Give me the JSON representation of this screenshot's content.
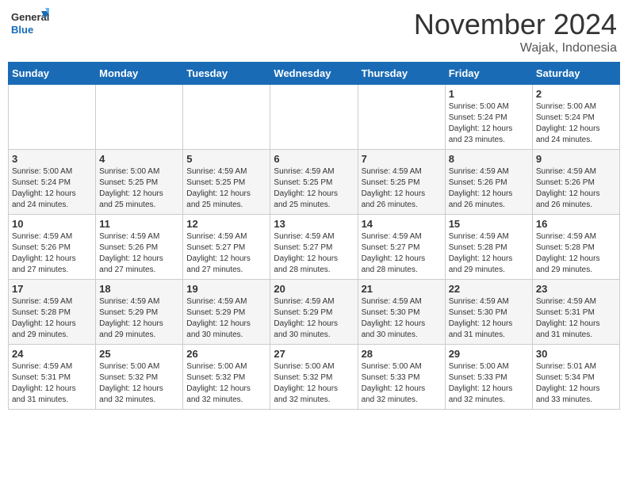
{
  "header": {
    "logo_general": "General",
    "logo_blue": "Blue",
    "month_title": "November 2024",
    "location": "Wajak, Indonesia"
  },
  "weekdays": [
    "Sunday",
    "Monday",
    "Tuesday",
    "Wednesday",
    "Thursday",
    "Friday",
    "Saturday"
  ],
  "weeks": [
    [
      {
        "day": "",
        "info": ""
      },
      {
        "day": "",
        "info": ""
      },
      {
        "day": "",
        "info": ""
      },
      {
        "day": "",
        "info": ""
      },
      {
        "day": "",
        "info": ""
      },
      {
        "day": "1",
        "info": "Sunrise: 5:00 AM\nSunset: 5:24 PM\nDaylight: 12 hours\nand 23 minutes."
      },
      {
        "day": "2",
        "info": "Sunrise: 5:00 AM\nSunset: 5:24 PM\nDaylight: 12 hours\nand 24 minutes."
      }
    ],
    [
      {
        "day": "3",
        "info": "Sunrise: 5:00 AM\nSunset: 5:24 PM\nDaylight: 12 hours\nand 24 minutes."
      },
      {
        "day": "4",
        "info": "Sunrise: 5:00 AM\nSunset: 5:25 PM\nDaylight: 12 hours\nand 25 minutes."
      },
      {
        "day": "5",
        "info": "Sunrise: 4:59 AM\nSunset: 5:25 PM\nDaylight: 12 hours\nand 25 minutes."
      },
      {
        "day": "6",
        "info": "Sunrise: 4:59 AM\nSunset: 5:25 PM\nDaylight: 12 hours\nand 25 minutes."
      },
      {
        "day": "7",
        "info": "Sunrise: 4:59 AM\nSunset: 5:25 PM\nDaylight: 12 hours\nand 26 minutes."
      },
      {
        "day": "8",
        "info": "Sunrise: 4:59 AM\nSunset: 5:26 PM\nDaylight: 12 hours\nand 26 minutes."
      },
      {
        "day": "9",
        "info": "Sunrise: 4:59 AM\nSunset: 5:26 PM\nDaylight: 12 hours\nand 26 minutes."
      }
    ],
    [
      {
        "day": "10",
        "info": "Sunrise: 4:59 AM\nSunset: 5:26 PM\nDaylight: 12 hours\nand 27 minutes."
      },
      {
        "day": "11",
        "info": "Sunrise: 4:59 AM\nSunset: 5:26 PM\nDaylight: 12 hours\nand 27 minutes."
      },
      {
        "day": "12",
        "info": "Sunrise: 4:59 AM\nSunset: 5:27 PM\nDaylight: 12 hours\nand 27 minutes."
      },
      {
        "day": "13",
        "info": "Sunrise: 4:59 AM\nSunset: 5:27 PM\nDaylight: 12 hours\nand 28 minutes."
      },
      {
        "day": "14",
        "info": "Sunrise: 4:59 AM\nSunset: 5:27 PM\nDaylight: 12 hours\nand 28 minutes."
      },
      {
        "day": "15",
        "info": "Sunrise: 4:59 AM\nSunset: 5:28 PM\nDaylight: 12 hours\nand 29 minutes."
      },
      {
        "day": "16",
        "info": "Sunrise: 4:59 AM\nSunset: 5:28 PM\nDaylight: 12 hours\nand 29 minutes."
      }
    ],
    [
      {
        "day": "17",
        "info": "Sunrise: 4:59 AM\nSunset: 5:28 PM\nDaylight: 12 hours\nand 29 minutes."
      },
      {
        "day": "18",
        "info": "Sunrise: 4:59 AM\nSunset: 5:29 PM\nDaylight: 12 hours\nand 29 minutes."
      },
      {
        "day": "19",
        "info": "Sunrise: 4:59 AM\nSunset: 5:29 PM\nDaylight: 12 hours\nand 30 minutes."
      },
      {
        "day": "20",
        "info": "Sunrise: 4:59 AM\nSunset: 5:29 PM\nDaylight: 12 hours\nand 30 minutes."
      },
      {
        "day": "21",
        "info": "Sunrise: 4:59 AM\nSunset: 5:30 PM\nDaylight: 12 hours\nand 30 minutes."
      },
      {
        "day": "22",
        "info": "Sunrise: 4:59 AM\nSunset: 5:30 PM\nDaylight: 12 hours\nand 31 minutes."
      },
      {
        "day": "23",
        "info": "Sunrise: 4:59 AM\nSunset: 5:31 PM\nDaylight: 12 hours\nand 31 minutes."
      }
    ],
    [
      {
        "day": "24",
        "info": "Sunrise: 4:59 AM\nSunset: 5:31 PM\nDaylight: 12 hours\nand 31 minutes."
      },
      {
        "day": "25",
        "info": "Sunrise: 5:00 AM\nSunset: 5:32 PM\nDaylight: 12 hours\nand 32 minutes."
      },
      {
        "day": "26",
        "info": "Sunrise: 5:00 AM\nSunset: 5:32 PM\nDaylight: 12 hours\nand 32 minutes."
      },
      {
        "day": "27",
        "info": "Sunrise: 5:00 AM\nSunset: 5:32 PM\nDaylight: 12 hours\nand 32 minutes."
      },
      {
        "day": "28",
        "info": "Sunrise: 5:00 AM\nSunset: 5:33 PM\nDaylight: 12 hours\nand 32 minutes."
      },
      {
        "day": "29",
        "info": "Sunrise: 5:00 AM\nSunset: 5:33 PM\nDaylight: 12 hours\nand 32 minutes."
      },
      {
        "day": "30",
        "info": "Sunrise: 5:01 AM\nSunset: 5:34 PM\nDaylight: 12 hours\nand 33 minutes."
      }
    ]
  ]
}
